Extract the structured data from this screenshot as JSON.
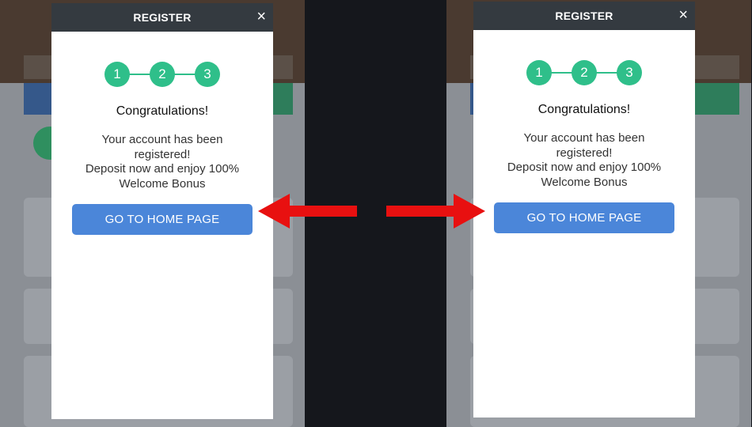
{
  "modal": {
    "title": "REGISTER",
    "close_glyph": "×",
    "steps": [
      "1",
      "2",
      "3"
    ],
    "heading": "Congratulations!",
    "message_lines": [
      "Your account has been",
      "registered!",
      "Deposit now and enjoy 100%",
      "Welcome Bonus"
    ],
    "home_button_label": "GO TO HOME PAGE"
  },
  "arrows": {
    "color": "#e81010",
    "left_direction": "left",
    "right_direction": "right"
  },
  "colors": {
    "header": "#343a40",
    "step": "#2fbf8a",
    "button": "#4b86d9"
  },
  "icons": {
    "close": "close-icon",
    "arrow_left": "arrow-left-icon",
    "arrow_right": "arrow-right-icon"
  }
}
